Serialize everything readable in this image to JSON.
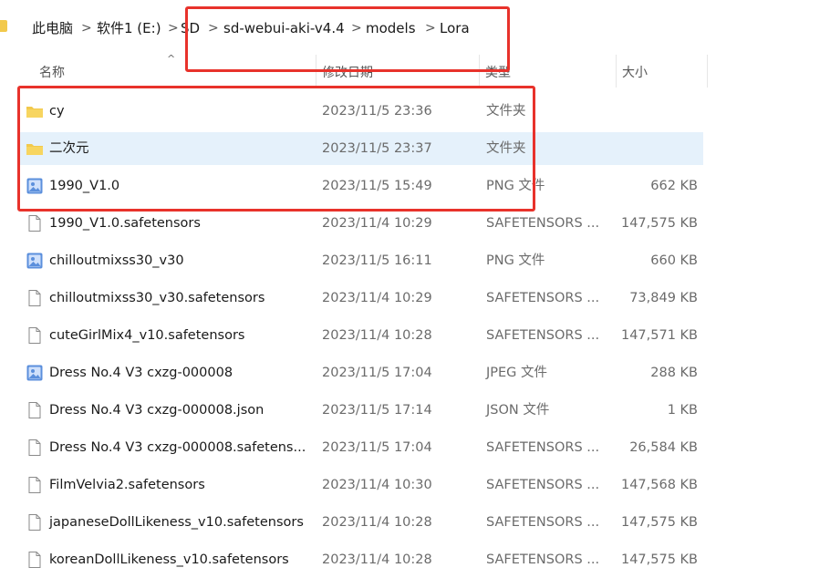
{
  "breadcrumb": {
    "items": [
      "此电脑",
      "软件1 (E:)",
      "SD",
      "sd-webui-aki-v4.4",
      "models",
      "Lora"
    ],
    "separator": ">"
  },
  "columns": {
    "name": "名称",
    "date": "修改日期",
    "type": "类型",
    "size": "大小"
  },
  "files": [
    {
      "name": "cy",
      "date": "2023/11/5 23:36",
      "type": "文件夹",
      "size": "",
      "icon": "folder-icon"
    },
    {
      "name": "二次元",
      "date": "2023/11/5 23:37",
      "type": "文件夹",
      "size": "",
      "icon": "folder-icon"
    },
    {
      "name": "1990_V1.0",
      "date": "2023/11/5 15:49",
      "type": "PNG 文件",
      "size": "662 KB",
      "icon": "image-file-icon"
    },
    {
      "name": "1990_V1.0.safetensors",
      "date": "2023/11/4 10:29",
      "type": "SAFETENSORS ...",
      "size": "147,575 KB",
      "icon": "document-file-icon"
    },
    {
      "name": "chilloutmixss30_v30",
      "date": "2023/11/5 16:11",
      "type": "PNG 文件",
      "size": "660 KB",
      "icon": "image-file-icon"
    },
    {
      "name": "chilloutmixss30_v30.safetensors",
      "date": "2023/11/4 10:29",
      "type": "SAFETENSORS ...",
      "size": "73,849 KB",
      "icon": "document-file-icon"
    },
    {
      "name": "cuteGirlMix4_v10.safetensors",
      "date": "2023/11/4 10:28",
      "type": "SAFETENSORS ...",
      "size": "147,571 KB",
      "icon": "document-file-icon"
    },
    {
      "name": "Dress No.4 V3 cxzg-000008",
      "date": "2023/11/5 17:04",
      "type": "JPEG 文件",
      "size": "288 KB",
      "icon": "image-file-icon"
    },
    {
      "name": "Dress No.4 V3 cxzg-000008.json",
      "date": "2023/11/5 17:14",
      "type": "JSON 文件",
      "size": "1 KB",
      "icon": "document-file-icon"
    },
    {
      "name": "Dress No.4 V3 cxzg-000008.safetens...",
      "date": "2023/11/5 17:04",
      "type": "SAFETENSORS ...",
      "size": "26,584 KB",
      "icon": "document-file-icon"
    },
    {
      "name": "FilmVelvia2.safetensors",
      "date": "2023/11/4 10:30",
      "type": "SAFETENSORS ...",
      "size": "147,568 KB",
      "icon": "document-file-icon"
    },
    {
      "name": "japaneseDollLikeness_v10.safetensors",
      "date": "2023/11/4 10:28",
      "type": "SAFETENSORS ...",
      "size": "147,575 KB",
      "icon": "document-file-icon"
    },
    {
      "name": "koreanDollLikeness_v10.safetensors",
      "date": "2023/11/4 10:28",
      "type": "SAFETENSORS ...",
      "size": "147,575 KB",
      "icon": "document-file-icon"
    }
  ],
  "selected_index": 1,
  "colors": {
    "selection": "#e5f1fb",
    "annotation": "#e8322b",
    "folder": "#f2c94c",
    "image_icon": "#5b8fdc"
  }
}
